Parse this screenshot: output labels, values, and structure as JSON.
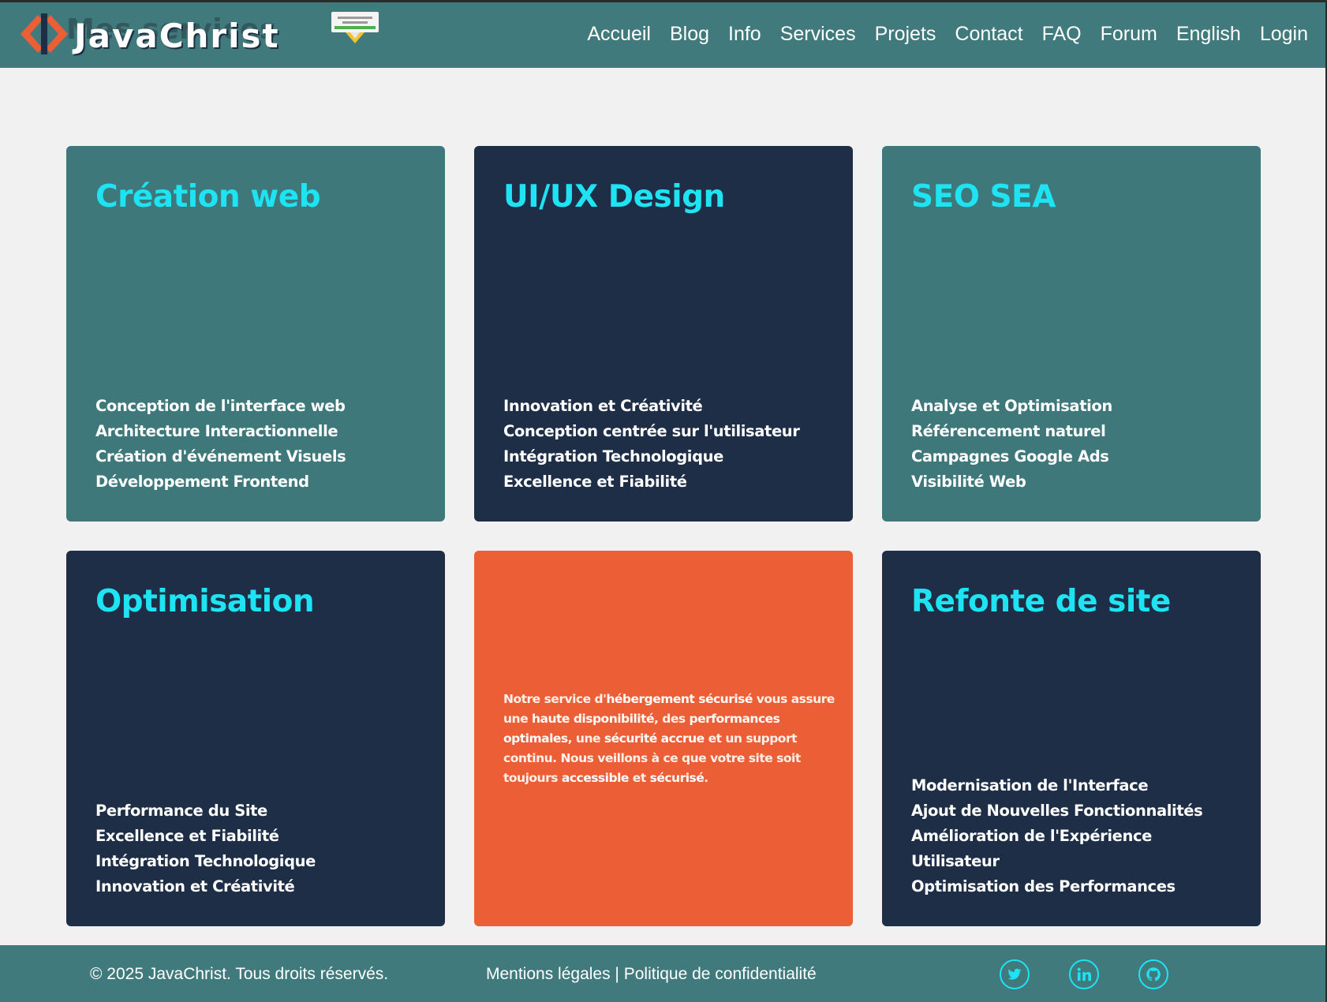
{
  "header": {
    "logo_ghost": "Mes services",
    "logo_text": "JavaChrist",
    "badge_icon": "certification-badge",
    "nav": [
      "Accueil",
      "Blog",
      "Info",
      "Services",
      "Projets",
      "Contact",
      "FAQ",
      "Forum",
      "English",
      "Login"
    ]
  },
  "cards": {
    "creation": {
      "title": "Création web",
      "items": [
        "Conception de l'interface web",
        "Architecture Interactionnelle",
        "Création d'événement Visuels",
        "Développement Frontend"
      ]
    },
    "uiux": {
      "title": "UI/UX Design",
      "items": [
        "Innovation et Créativité",
        "Conception centrée sur l'utilisateur",
        "Intégration Technologique",
        "Excellence et Fiabilité"
      ]
    },
    "seo": {
      "title": "SEO SEA",
      "items": [
        "Analyse et Optimisation",
        "Référencement naturel",
        "Campagnes Google Ads",
        "Visibilité Web"
      ]
    },
    "optimisation": {
      "title": "Optimisation",
      "items": [
        "Performance du Site",
        "Excellence et Fiabilité",
        "Intégration Technologique",
        "Innovation et Créativité"
      ]
    },
    "hosting": {
      "t1": "Notre service d'",
      "b1": "hébergement sécurisé",
      "t2": " vous assure une ",
      "b2": "haute disponibilité",
      "t3": ", des ",
      "b3": "performances optimales",
      "t4": ", une ",
      "b4": "sécurité accrue",
      "t5": " et un support continu. Nous veillons à ce que votre site soit toujours ",
      "b5": "accessible",
      "t6": " et ",
      "b6": "sécurisé",
      "t7": "."
    },
    "refonte": {
      "title": "Refonte de site",
      "items": [
        "Modernisation de l'Interface",
        "Ajout de Nouvelles Fonctionnalités",
        "Amélioration de l'Expérience",
        "Utilisateur",
        "Optimisation des Performances"
      ]
    }
  },
  "footer": {
    "copyright": "© 2025 JavaChrist. Tous droits réservés.",
    "legal": "Mentions légales | Politique de confidentialité",
    "social_icons": [
      "twitter-icon",
      "linkedin-icon",
      "github-icon"
    ]
  },
  "colors": {
    "teal": "#3e787a",
    "navy": "#1d2e46",
    "orange": "#ec5e35",
    "accent": "#1ee3f3"
  }
}
